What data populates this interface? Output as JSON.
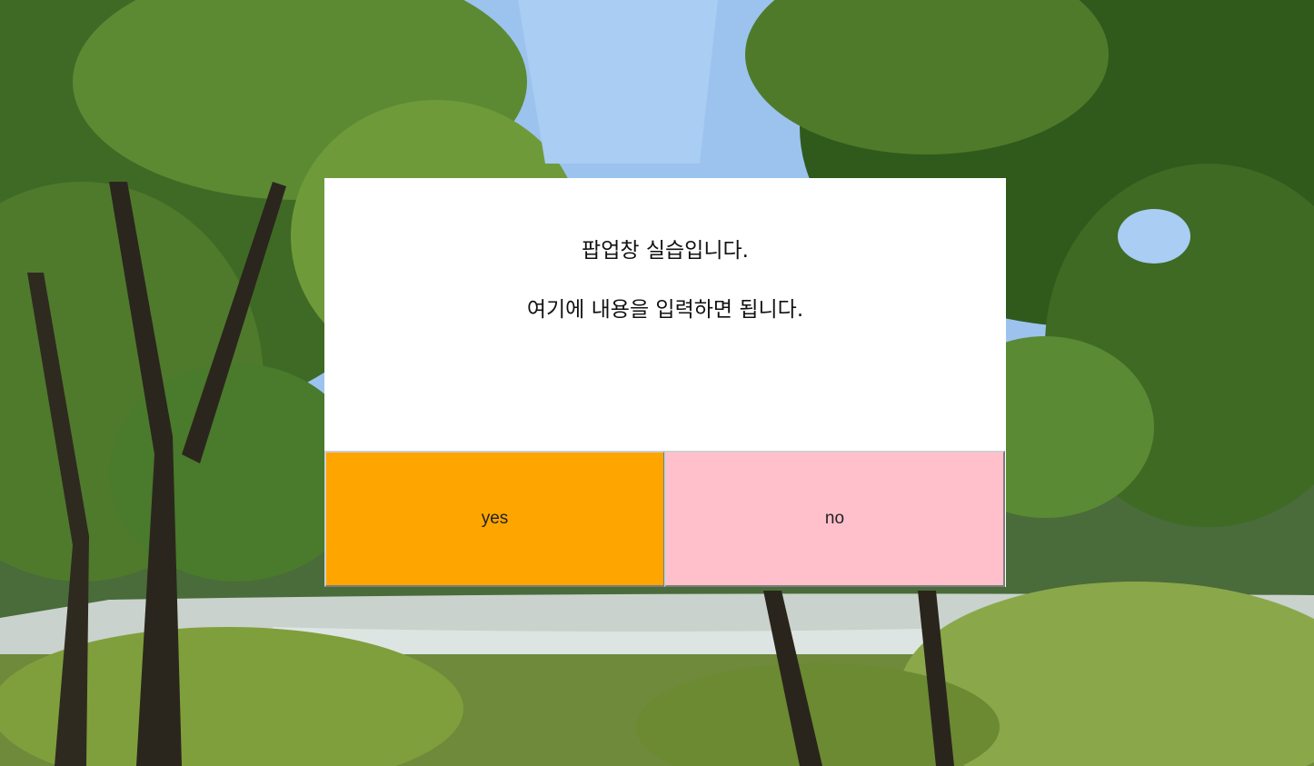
{
  "popup": {
    "line1": "팝업창 실습입니다.",
    "line2": "여기에 내용을 입력하면 됩니다.",
    "yes_label": "yes",
    "no_label": "no"
  },
  "colors": {
    "yes_button": "#ffa500",
    "no_button": "#ffc0cb",
    "popup_background": "#ffffff"
  }
}
